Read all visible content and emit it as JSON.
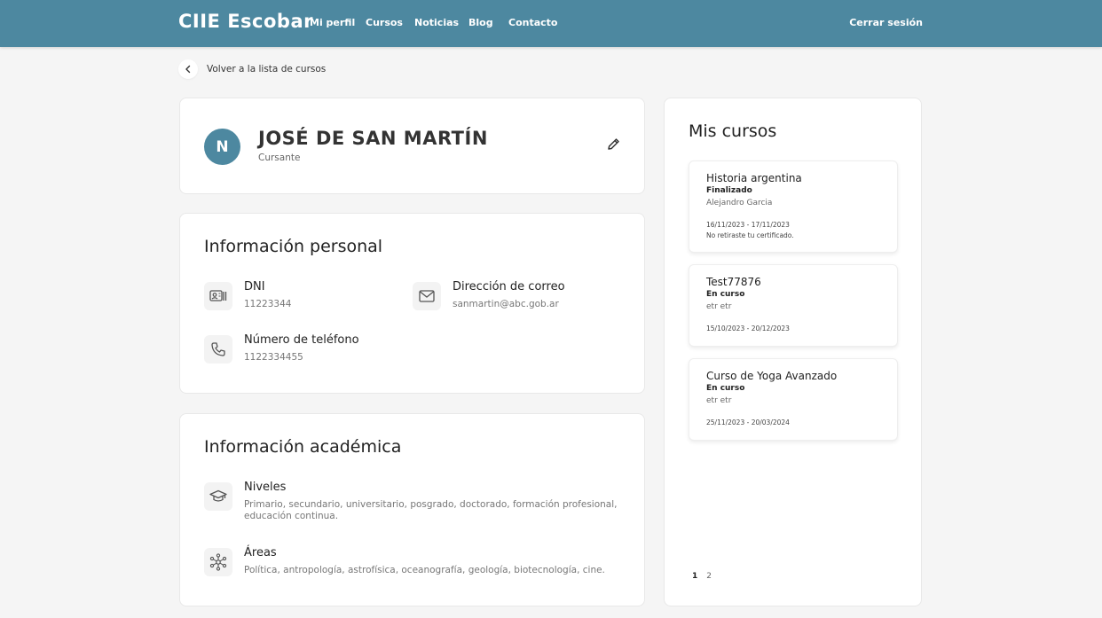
{
  "header": {
    "brand": "CIIE Escobar",
    "nav": [
      "Mi perfil",
      "Cursos",
      "Noticias",
      "Blog",
      "Contacto"
    ],
    "logout": "Cerrar sesión",
    "color": "#4d88a0"
  },
  "back_link": "Volver a la lista de cursos",
  "profile": {
    "initial": "N",
    "name": "JOSÉ DE SAN MARTÍN",
    "role": "Cursante"
  },
  "personal": {
    "title": "Información personal",
    "dni": {
      "label": "DNI",
      "value": "11223344",
      "icon": "id-card-icon"
    },
    "email": {
      "label": "Dirección de correo",
      "value": "sanmartin@abc.gob.ar",
      "icon": "mail-icon"
    },
    "phone": {
      "label": "Número de teléfono",
      "value": "1122334455",
      "icon": "phone-icon"
    }
  },
  "academic": {
    "title": "Información académica",
    "levels": {
      "label": "Niveles",
      "value": "Primario, secundario, universitario, posgrado, doctorado, formación profesional, educación continua.",
      "icon": "graduation-cap-icon"
    },
    "areas": {
      "label": "Áreas",
      "value": "Política, antropología, astrofísica, oceanografía, geología, biotecnología, cine.",
      "icon": "network-icon"
    }
  },
  "courses": {
    "title": "Mis cursos",
    "items": [
      {
        "title": "Historia argentina",
        "status": "Finalizado",
        "teacher": "Alejandro Garcia",
        "dates": "16/11/2023 - 17/11/2023",
        "note": "No retiraste tu certificado."
      },
      {
        "title": "Test77876",
        "status": "En curso",
        "teacher": "etr etr",
        "dates": "15/10/2023 - 20/12/2023"
      },
      {
        "title": "Curso de Yoga Avanzado",
        "status": "En curso",
        "teacher": "etr etr",
        "dates": "25/11/2023 - 20/03/2024"
      }
    ],
    "pages": [
      "1",
      "2"
    ]
  }
}
